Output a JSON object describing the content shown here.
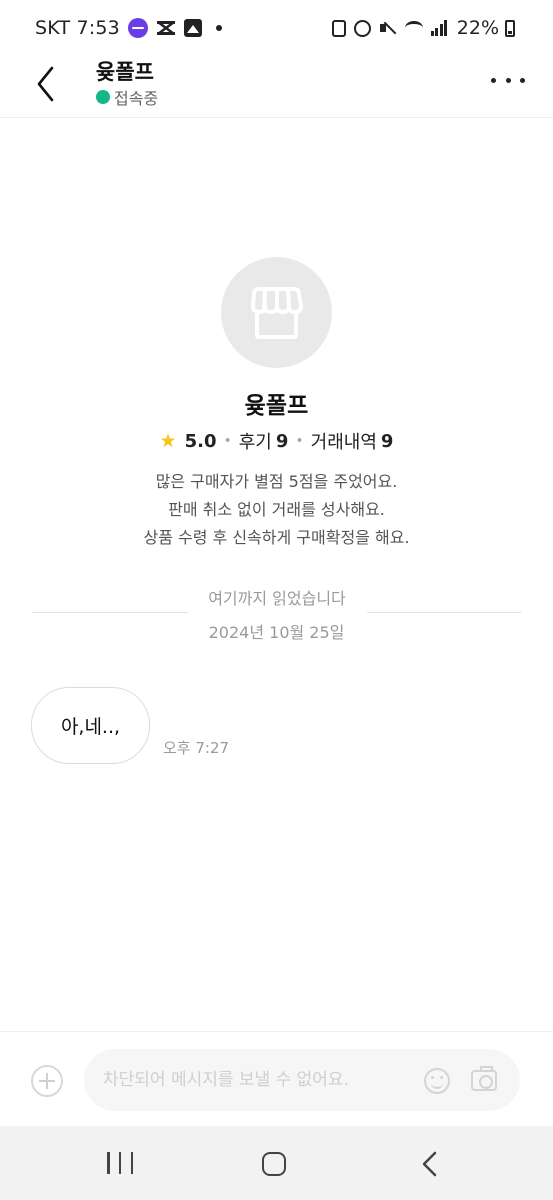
{
  "status_bar": {
    "carrier_time": "SKT 7:53",
    "battery": "22%"
  },
  "header": {
    "title": "윶폴프",
    "status": "접속중",
    "status_color": "#12b886"
  },
  "profile": {
    "name": "윶폴프",
    "rating": "5.0",
    "reviews_label": "후기",
    "reviews_count": "9",
    "trades_label": "거래내역",
    "trades_count": "9",
    "badges": [
      "많은 구매자가 별점 5점을 주었어요.",
      "판매 취소 없이 거래를 성사해요.",
      "상품 수령 후 신속하게 구매확정을 해요."
    ]
  },
  "chat": {
    "read_marker": "여기까지 읽었습니다",
    "date": "2024년 10월 25일",
    "messages": [
      {
        "text": "아,네..,",
        "time": "오후 7:27"
      }
    ]
  },
  "input": {
    "placeholder": "차단되어 메시지를 보낼 수 없어요."
  },
  "icons": {
    "back": "chevron-left-icon",
    "more": "more-horizontal-icon",
    "avatar": "storefront-icon",
    "rating": "star-icon",
    "add": "plus-circle-icon",
    "emoji": "smiley-icon",
    "camera": "camera-icon"
  },
  "colors": {
    "star": "#f5c518",
    "online": "#12b886"
  }
}
